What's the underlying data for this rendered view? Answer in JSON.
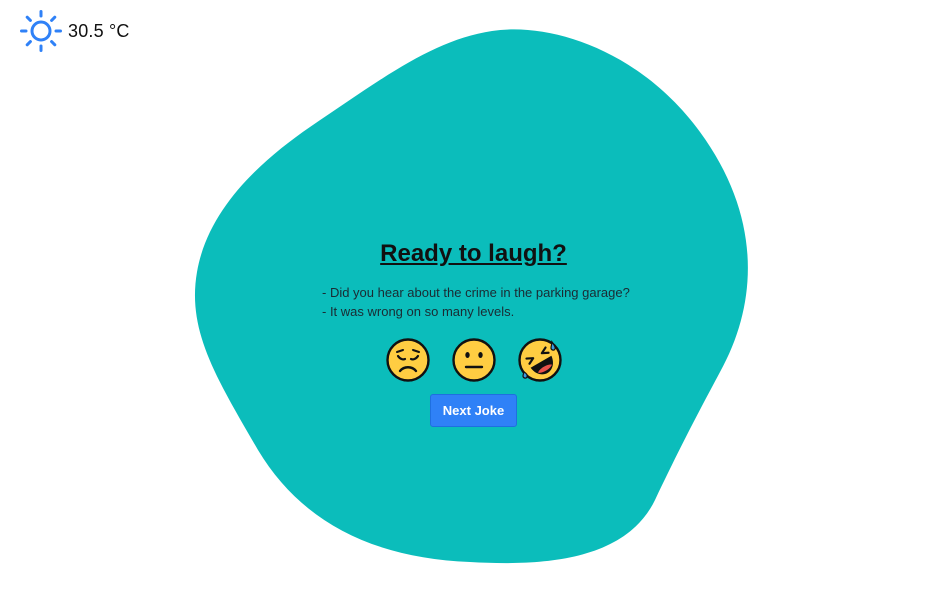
{
  "weather": {
    "icon": "sun-icon",
    "temperature": "30.5 °C"
  },
  "colors": {
    "blob": "#0bbdbb",
    "accent": "#2f81f7",
    "emoji_face": "#ffcd42"
  },
  "joke_card": {
    "title": "Ready to laugh?",
    "lines": [
      "- Did you hear about the crime in the parking garage?",
      "- It was wrong on so many levels."
    ],
    "reactions": [
      {
        "icon": "disappointed-face-icon"
      },
      {
        "icon": "neutral-face-icon"
      },
      {
        "icon": "rolling-on-floor-laughing-icon"
      }
    ],
    "next_button_label": "Next Joke"
  }
}
